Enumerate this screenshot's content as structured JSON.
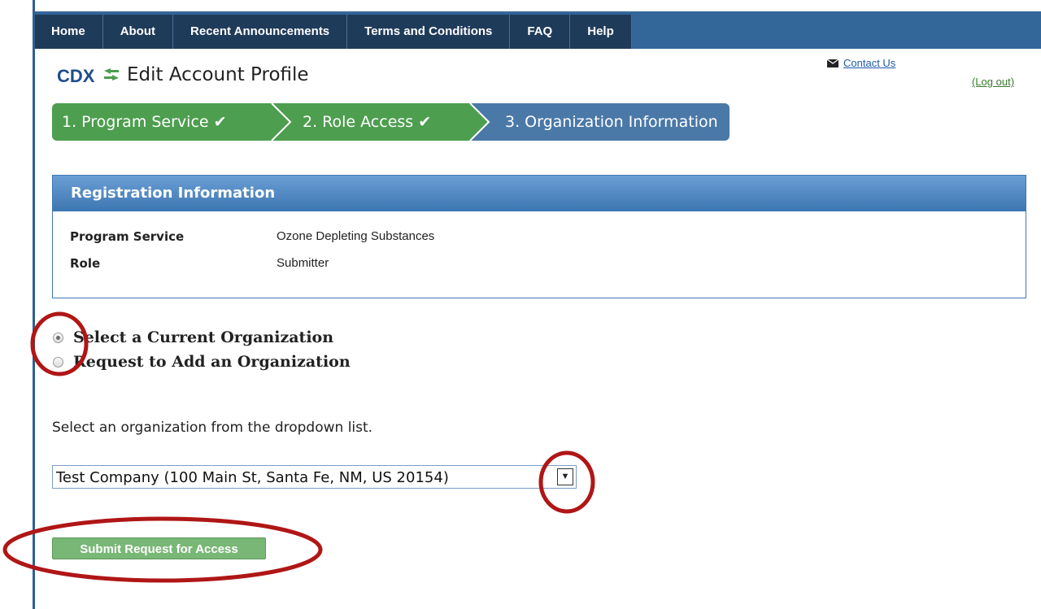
{
  "nav": {
    "items": [
      "Home",
      "About",
      "Recent Announcements",
      "Terms and Conditions",
      "FAQ",
      "Help"
    ]
  },
  "header": {
    "logo_text": "CDX",
    "title": "Edit Account Profile",
    "contact_label": "Contact Us",
    "logout_label": "(Log out)"
  },
  "wizard": {
    "steps": [
      {
        "label": "1. Program Service ✔",
        "state": "complete"
      },
      {
        "label": "2. Role Access ✔",
        "state": "complete"
      },
      {
        "label": "3. Organization Information",
        "state": "current"
      }
    ]
  },
  "registration": {
    "heading": "Registration Information",
    "rows": [
      {
        "label": "Program Service",
        "value": "Ozone Depleting Substances"
      },
      {
        "label": "Role",
        "value": "Submitter"
      }
    ]
  },
  "org_choice": {
    "options": [
      {
        "label": "Select a Current Organization",
        "checked": true
      },
      {
        "label": "Request to Add an Organization",
        "checked": false
      }
    ]
  },
  "instruction": "Select an organization from the dropdown list.",
  "org_select": {
    "value": "Test Company (100 Main St, Santa Fe, NM, US 20154)",
    "arrow_glyph": "▼"
  },
  "submit_label": "Submit Request for Access",
  "colors": {
    "nav_bar": "#336699",
    "nav_item": "#1f3b5a",
    "step_complete": "#4d9e4f",
    "step_current": "#4a79a8",
    "panel_head": "#3d76b2",
    "submit": "#79b776",
    "annotation": "#b01616"
  },
  "icons": [
    "cdx-logo-icon",
    "envelope-icon",
    "checkmark-icon",
    "chevron-down-icon"
  ]
}
